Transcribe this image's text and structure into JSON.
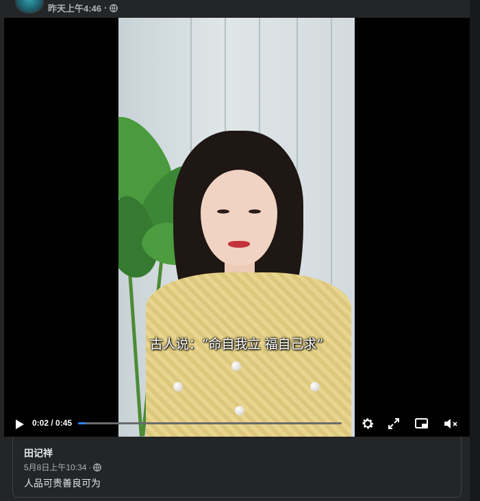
{
  "post": {
    "timestamp": "昨天上午4:46",
    "separator": "·",
    "privacy_icon": "globe-icon"
  },
  "video": {
    "subtitle": "古人说：“命自我立 福自己求”",
    "current_time": "0:02",
    "duration": "0:45",
    "time_separator": " / ",
    "progress_fraction": 0.03,
    "icons": [
      "play-icon",
      "gear-icon",
      "fullscreen-icon",
      "miniplayer-icon",
      "volume-muted-icon"
    ]
  },
  "comment": {
    "author": "田记祥",
    "timestamp": "5月8日上午10:34",
    "separator": "·",
    "text": "人品可贵善良可为"
  },
  "colors": {
    "accent": "#2d88ff",
    "card": "#242526",
    "text_secondary": "#b0b3b8"
  }
}
